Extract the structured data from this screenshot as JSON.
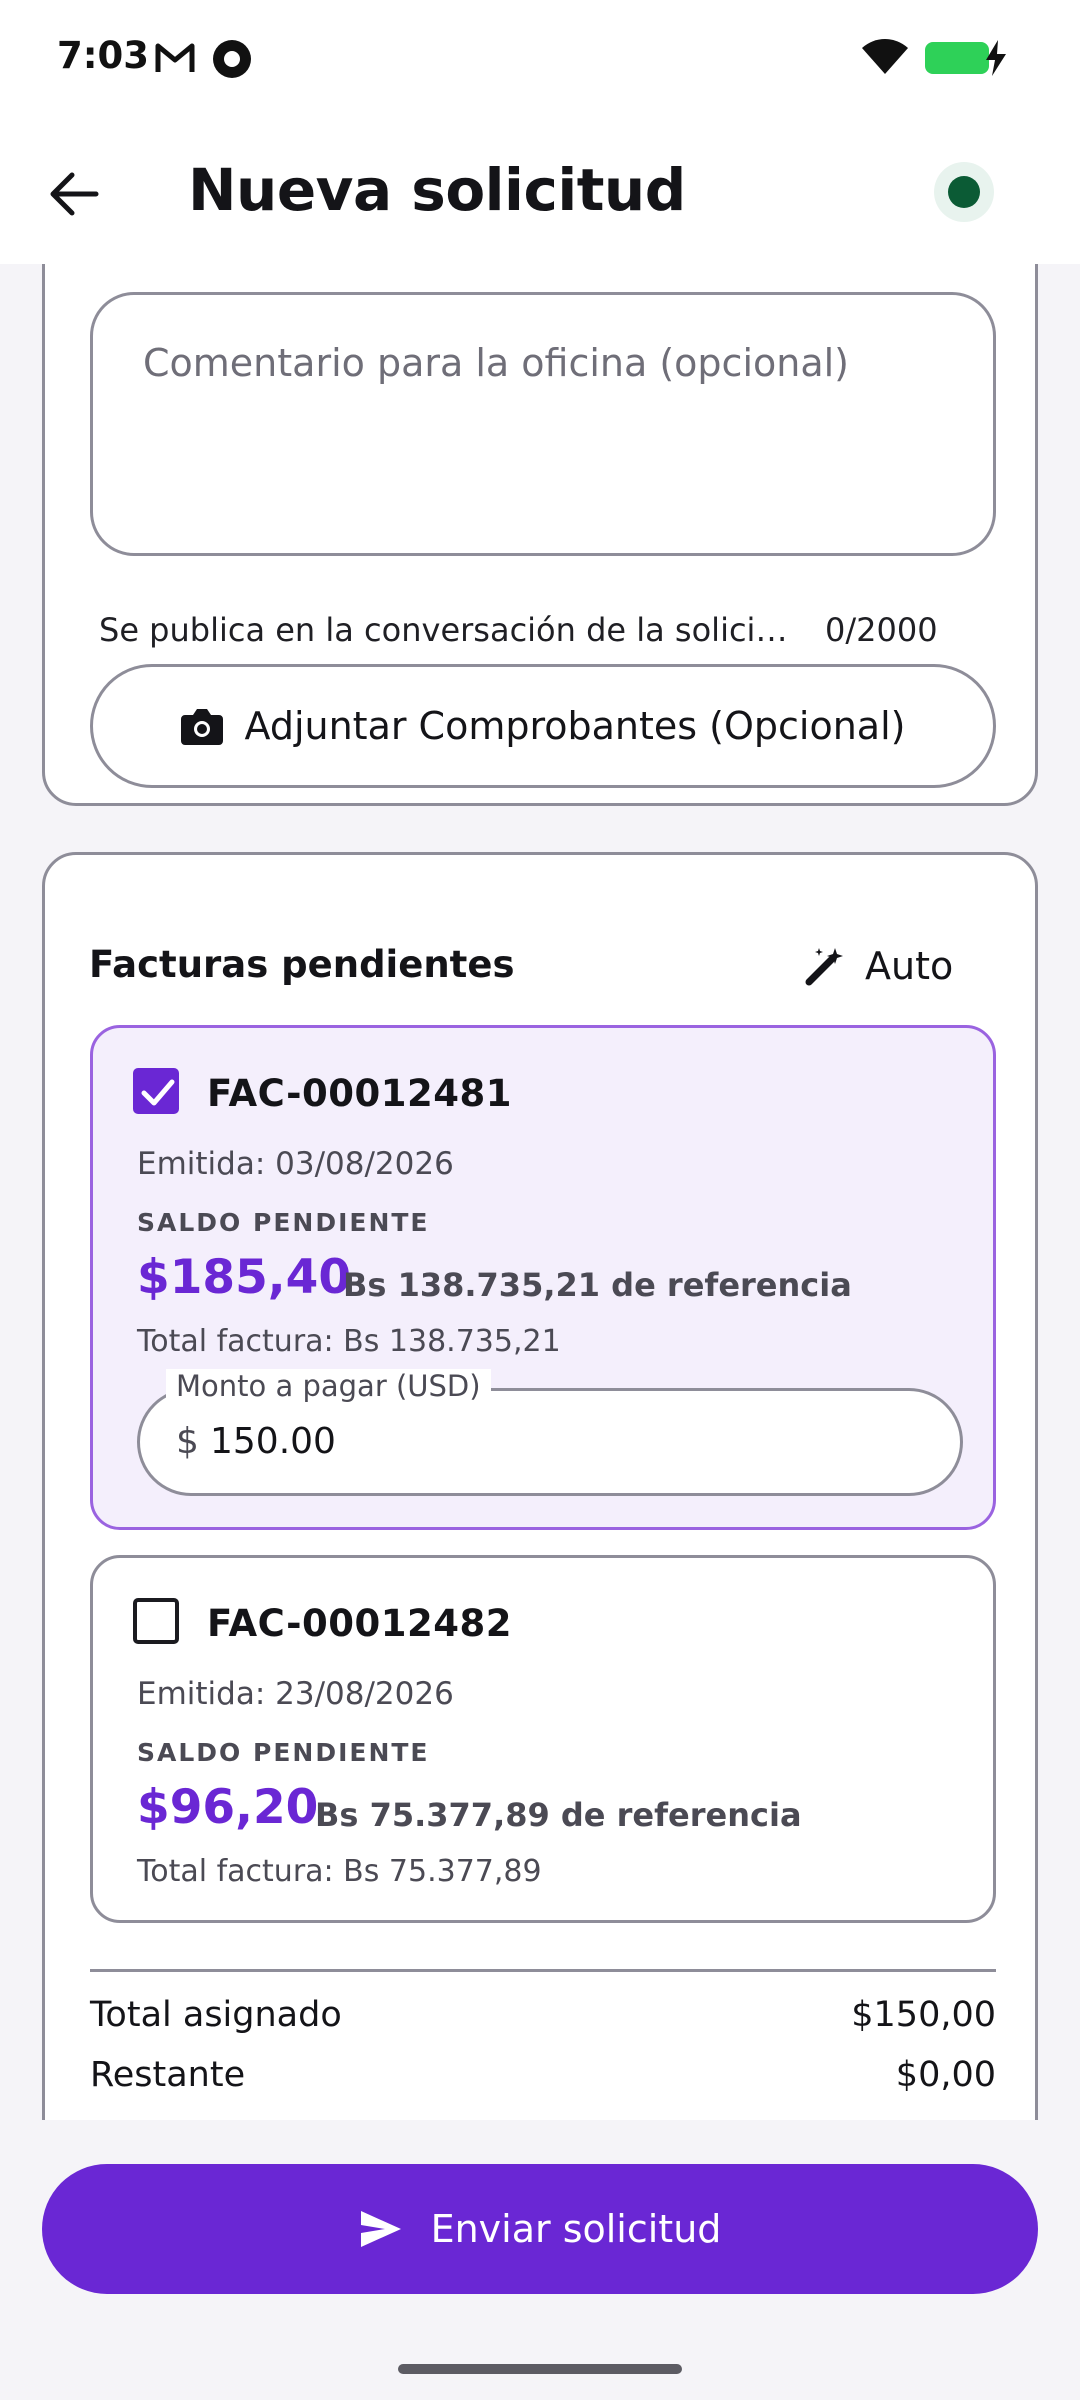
{
  "status_bar": {
    "time": "7:03"
  },
  "app_bar": {
    "title": "Nueva solicitud"
  },
  "comment": {
    "placeholder": "Comentario para la oficina (opcional)",
    "helper": "Se publica en la conversación de la solicitud",
    "counter": "0/2000"
  },
  "attach": {
    "label": "Adjuntar Comprobantes (Opcional)"
  },
  "invoices_section": {
    "title": "Facturas pendientes",
    "auto_label": "Auto",
    "items": [
      {
        "number": "FAC-00012481",
        "issued": "Emitida: 03/08/2026",
        "saldo_label": "SALDO PENDIENTE",
        "amount": "$185,40",
        "reference": "Bs 138.735,21 de referencia",
        "total": "Total factura: Bs 138.735,21",
        "selected": true,
        "pay_label": "Monto a pagar (USD)",
        "pay_prefix": "$",
        "pay_value": "150.00"
      },
      {
        "number": "FAC-00012482",
        "issued": "Emitida: 23/08/2026",
        "saldo_label": "SALDO PENDIENTE",
        "amount": "$96,20",
        "reference": "Bs 75.377,89 de referencia",
        "total": "Total factura: Bs 75.377,89",
        "selected": false
      }
    ]
  },
  "summary": {
    "assigned_label": "Total asignado",
    "assigned_value": "$150,00",
    "remaining_label": "Restante",
    "remaining_value": "$0,00"
  },
  "send": {
    "label": "Enviar solicitud"
  },
  "colors": {
    "accent": "#6a27d4",
    "status_dot": "#0b5b35",
    "selected_bg": "#f4effc"
  }
}
